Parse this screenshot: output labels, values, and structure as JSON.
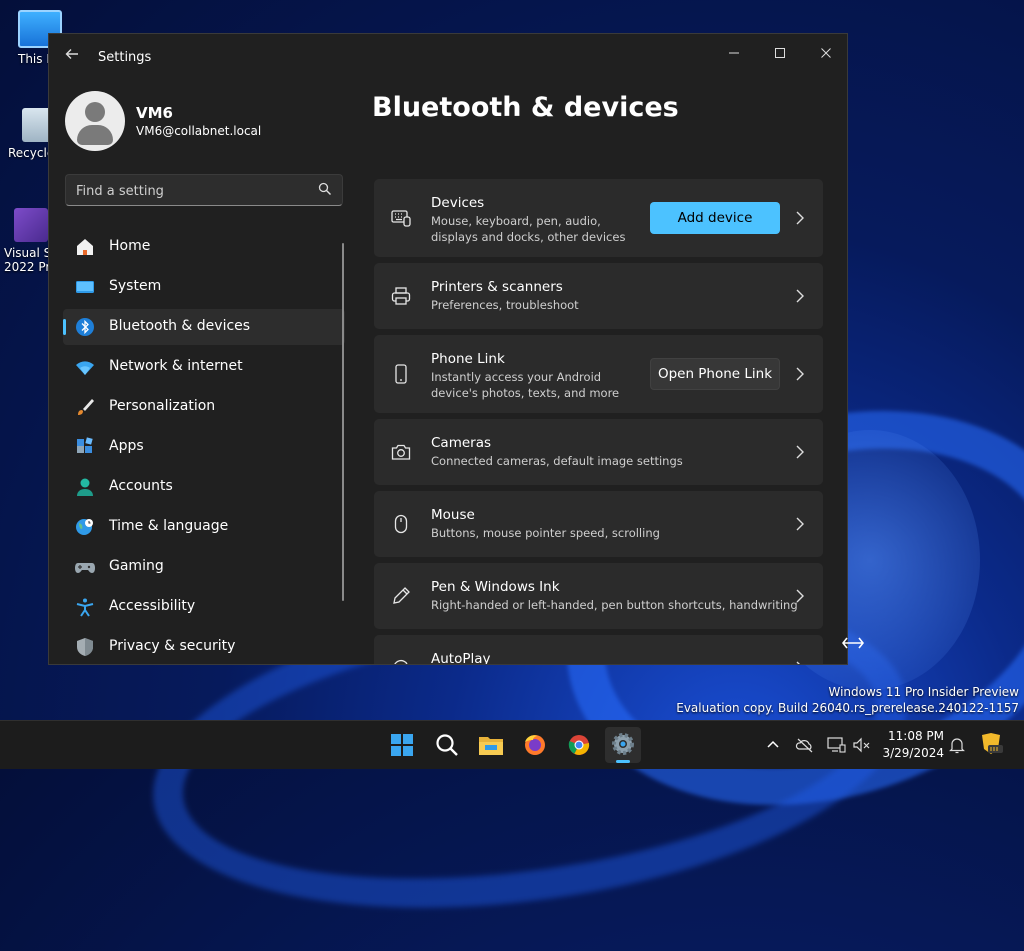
{
  "desktop": {
    "icons": [
      {
        "label": "This P"
      },
      {
        "label": "Recycle"
      },
      {
        "label": "Visual St"
      },
      {
        "label": "2022 Pre"
      }
    ],
    "watermark": {
      "line1": "Windows 11 Pro Insider Preview",
      "line2": "Evaluation copy. Build 26040.rs_prerelease.240122-1157"
    }
  },
  "window": {
    "title": "Settings",
    "controls": {
      "minimize": "—",
      "maximize": "☐",
      "close": "✕"
    }
  },
  "account": {
    "name": "VM6",
    "email": "VM6@collabnet.local"
  },
  "search": {
    "placeholder": "Find a setting"
  },
  "nav": {
    "items": [
      {
        "label": "Home",
        "icon": "home-icon"
      },
      {
        "label": "System",
        "icon": "system-icon"
      },
      {
        "label": "Bluetooth & devices",
        "icon": "bluetooth-icon",
        "selected": true
      },
      {
        "label": "Network & internet",
        "icon": "wifi-icon"
      },
      {
        "label": "Personalization",
        "icon": "brush-icon"
      },
      {
        "label": "Apps",
        "icon": "apps-icon"
      },
      {
        "label": "Accounts",
        "icon": "person-icon"
      },
      {
        "label": "Time & language",
        "icon": "globe-clock-icon"
      },
      {
        "label": "Gaming",
        "icon": "gamepad-icon"
      },
      {
        "label": "Accessibility",
        "icon": "accessibility-icon"
      },
      {
        "label": "Privacy & security",
        "icon": "shield-icon"
      }
    ]
  },
  "page": {
    "title": "Bluetooth & devices"
  },
  "cards": [
    {
      "title": "Devices",
      "desc": "Mouse, keyboard, pen, audio, displays and docks, other devices",
      "button": "Add device",
      "icon": "devices-icon"
    },
    {
      "title": "Printers & scanners",
      "desc": "Preferences, troubleshoot",
      "icon": "printer-icon"
    },
    {
      "title": "Phone Link",
      "desc": "Instantly access your Android device's photos, texts, and more",
      "button": "Open Phone Link",
      "icon": "phone-icon"
    },
    {
      "title": "Cameras",
      "desc": "Connected cameras, default image settings",
      "icon": "camera-icon"
    },
    {
      "title": "Mouse",
      "desc": "Buttons, mouse pointer speed, scrolling",
      "icon": "mouse-icon"
    },
    {
      "title": "Pen & Windows Ink",
      "desc": "Right-handed or left-handed, pen button shortcuts, handwriting",
      "icon": "pen-icon"
    },
    {
      "title": "AutoPlay",
      "icon": "autoplay-icon"
    }
  ],
  "taskbar": {
    "apps": [
      "start-icon",
      "search-icon",
      "file-explorer-icon",
      "firefox-icon",
      "chrome-icon",
      "settings-icon"
    ],
    "clock": {
      "time": "11:08 PM",
      "date": "3/29/2024"
    }
  },
  "colors": {
    "accent": "#4cc2ff",
    "window_bg": "#202020",
    "card_bg": "#2b2b2b"
  }
}
